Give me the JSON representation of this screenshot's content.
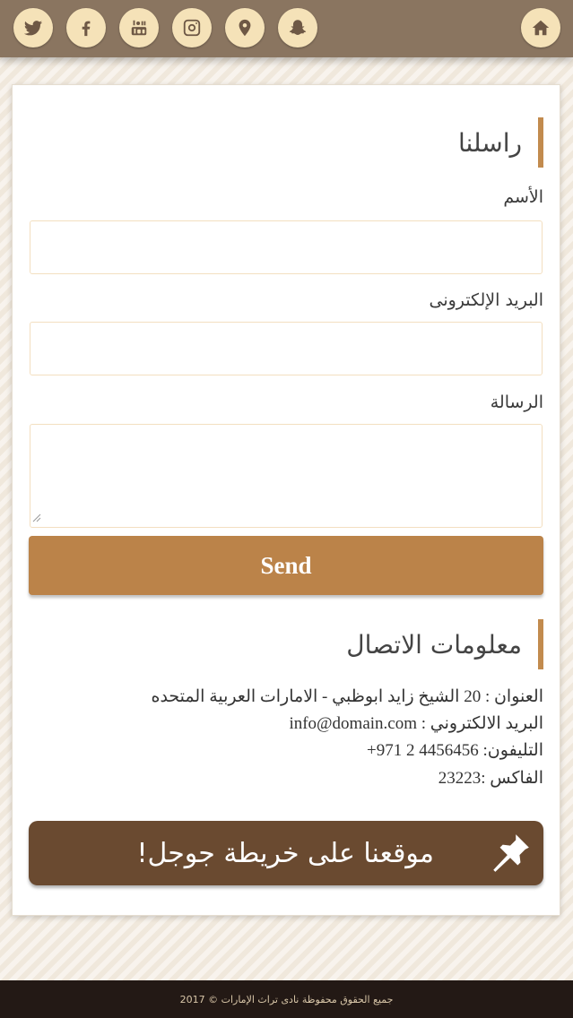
{
  "header": {
    "social_icons": [
      "twitter-icon",
      "facebook-icon",
      "youtube-icon",
      "instagram-icon",
      "map-pin-icon",
      "snapchat-icon"
    ],
    "home_icon": "home-icon"
  },
  "contact_form": {
    "title": "راسلنا",
    "name_label": "الأسم",
    "name_value": "",
    "email_label": "البريد الإلكترونى",
    "email_value": "",
    "message_label": "الرسالة",
    "message_value": "",
    "send_label": "Send"
  },
  "contact_info": {
    "title": "معلومات الاتصال",
    "address": "العنوان : 20 الشيخ زايد ابوظبي - الامارات العربية المتحده",
    "email": "البريد الالكتروني : info@domain.com",
    "phone": "التليفون: 4456456 2 971+",
    "fax": "الفاكس :23223"
  },
  "map_button": {
    "label": "موقعنا على خريطة جوجل!",
    "icon": "pushpin-icon"
  },
  "footer": {
    "copyright": "2017 © جميع الحقوق محفوظة نادى تراث الإمارات"
  },
  "colors": {
    "topbar": "#8a7560",
    "icon_bg": "#f5e2b8",
    "accent": "#bb8349",
    "map_button": "#6a4a30",
    "footer": "#231915"
  }
}
